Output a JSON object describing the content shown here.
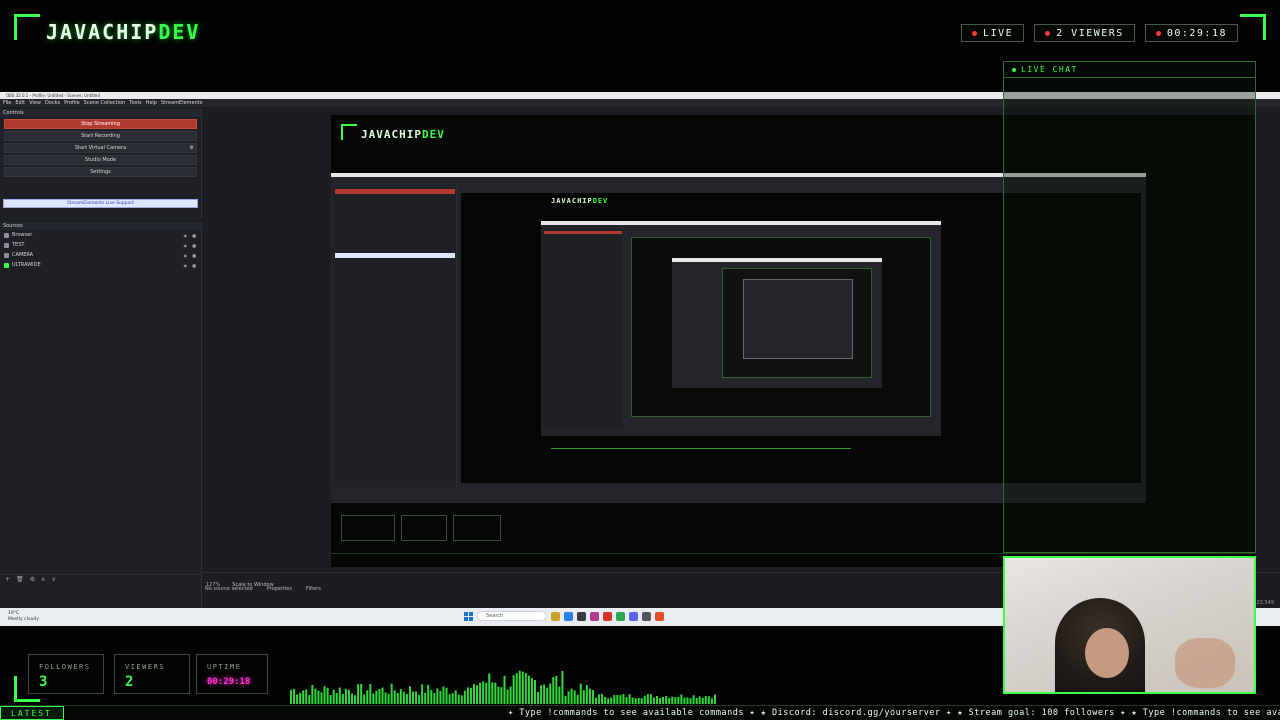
{
  "overlay": {
    "brand_main": "JAVACHIP",
    "brand_accent": "DEV",
    "live_label": "LIVE",
    "viewers_label": "2  VIEWERS",
    "uptime_top": "00:29:18",
    "chat_title": "LIVE CHAT",
    "stats": [
      {
        "label": "FOLLOWERS",
        "value": "3"
      },
      {
        "label": "VIEWERS",
        "value": "2"
      },
      {
        "label": "UPTIME",
        "value": "00:29:18"
      }
    ],
    "latest_label": "LATEST",
    "ticker": "✦ Type !commands to see available commands ✦ ★ Discord: discord.gg/yourserver ✦ ★ Stream goal: 100 followers ✦ ★ Type !commands to see available commands ✦",
    "colors": {
      "accent": "#39ff4a",
      "uptime": "#ff2fd0",
      "background": "#020302"
    }
  },
  "obs": {
    "title": "OBS 32.0.1 - Profile: Untitled - Scenes: Untitled",
    "menu": [
      "File",
      "Edit",
      "View",
      "Docks",
      "Profile",
      "Scene Collection",
      "Tools",
      "Help",
      "StreamElements"
    ],
    "controls_title": "Controls",
    "controls": [
      "Stop Streaming",
      "Start Recording",
      "Start Virtual Camera",
      "Studio Mode",
      "Settings"
    ],
    "support_label": "StreamElements Live Support",
    "sources_title": "Sources",
    "sources": [
      {
        "name": "Browser",
        "icon": "browser-icon"
      },
      {
        "name": "TEST",
        "icon": "image-icon"
      },
      {
        "name": "CAMERA",
        "icon": "camera-icon"
      },
      {
        "name": "ULTRAWIDE",
        "icon": "display-icon"
      }
    ],
    "dock_footer": [
      "+",
      "🗑",
      "⚙",
      "∧",
      "∨"
    ],
    "zoom": "127%",
    "scale_mode": "Scale to Window",
    "no_source": "No source selected",
    "properties_label": "Properties",
    "filters_label": "Filters",
    "status": "Dropped Frames 0 (0.0%)   26.23.549"
  },
  "taskbar": {
    "weather_line1": "19°C",
    "weather_line2": "Mostly cloudy",
    "search_placeholder": "Search"
  }
}
